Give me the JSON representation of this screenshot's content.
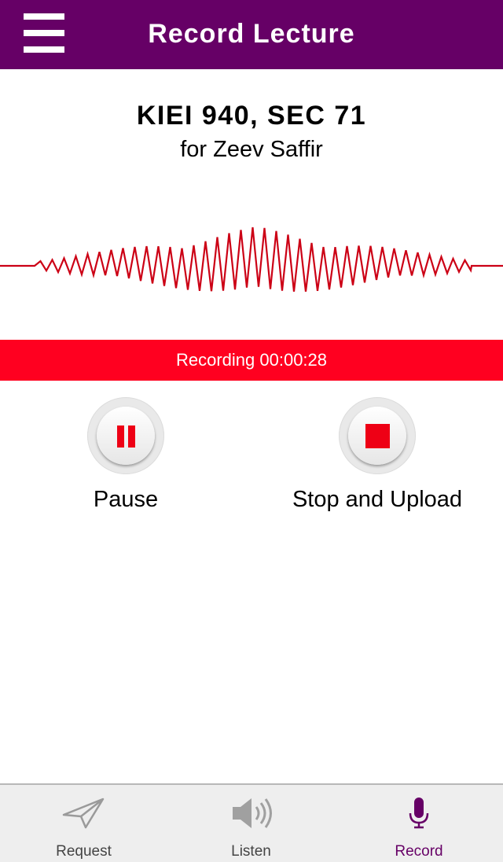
{
  "header": {
    "title": "Record Lecture",
    "menu_icon": "hamburger-menu-icon"
  },
  "course": {
    "title": "KIEI 940, SEC 71",
    "subtitle": "for Zeev Saffir"
  },
  "recording": {
    "status_text": "Recording 00:00:28",
    "bar_color": "#ff0020"
  },
  "controls": {
    "pause": {
      "label": "Pause",
      "icon": "pause-icon"
    },
    "stop": {
      "label": "Stop and Upload",
      "icon": "stop-icon"
    }
  },
  "tabs": [
    {
      "label": "Request",
      "icon": "paper-plane-icon",
      "active": false
    },
    {
      "label": "Listen",
      "icon": "speaker-icon",
      "active": false
    },
    {
      "label": "Record",
      "icon": "microphone-icon",
      "active": true
    }
  ],
  "colors": {
    "brand": "#660066",
    "accent_red": "#ee0015",
    "waveform": "#cc0015"
  }
}
